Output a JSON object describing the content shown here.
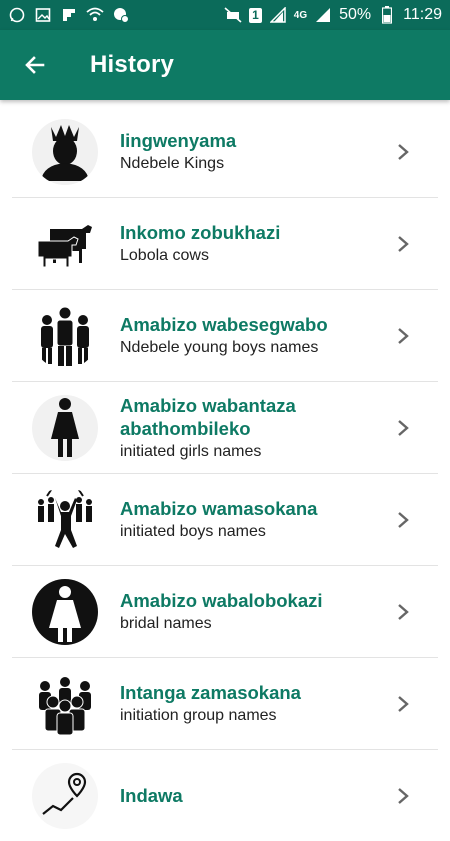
{
  "status_bar": {
    "battery": "50%",
    "time": "11:29",
    "sim_badge": "1",
    "network": "4G",
    "icons": [
      "whatsapp-icon",
      "photo-icon",
      "flipboard-icon",
      "wifi-icon",
      "chat-icon",
      "mute-icon",
      "signal-icon",
      "battery-icon"
    ]
  },
  "app_bar": {
    "title": "History",
    "back_icon": "arrow-left-icon"
  },
  "items": [
    {
      "title": "Iingwenyama",
      "subtitle": "Ndebele Kings",
      "icon": "king-icon"
    },
    {
      "title": "Inkomo zobukhazi",
      "subtitle": "Lobola cows",
      "icon": "cows-icon"
    },
    {
      "title": "Amabizo wabesegwabo",
      "subtitle": "Ndebele young boys names",
      "icon": "boys-group-icon"
    },
    {
      "title": "Amabizo wabantaza abathombileko",
      "subtitle": "initiated girls names",
      "icon": "girl-icon"
    },
    {
      "title": "Amabizo wamasokana",
      "subtitle": "initiated boys names",
      "icon": "dancing-crowd-icon"
    },
    {
      "title": "Amabizo wabalobokazi",
      "subtitle": "bridal names",
      "icon": "bride-icon"
    },
    {
      "title": "Intanga zamasokana",
      "subtitle": "initiation group names",
      "icon": "crowd-icon"
    },
    {
      "title": "Indawa",
      "subtitle": "",
      "icon": "map-pin-icon"
    }
  ],
  "colors": {
    "status_bar": "#0b6b5a",
    "app_bar": "#0e7a64",
    "title_text": "#0e7a64"
  }
}
